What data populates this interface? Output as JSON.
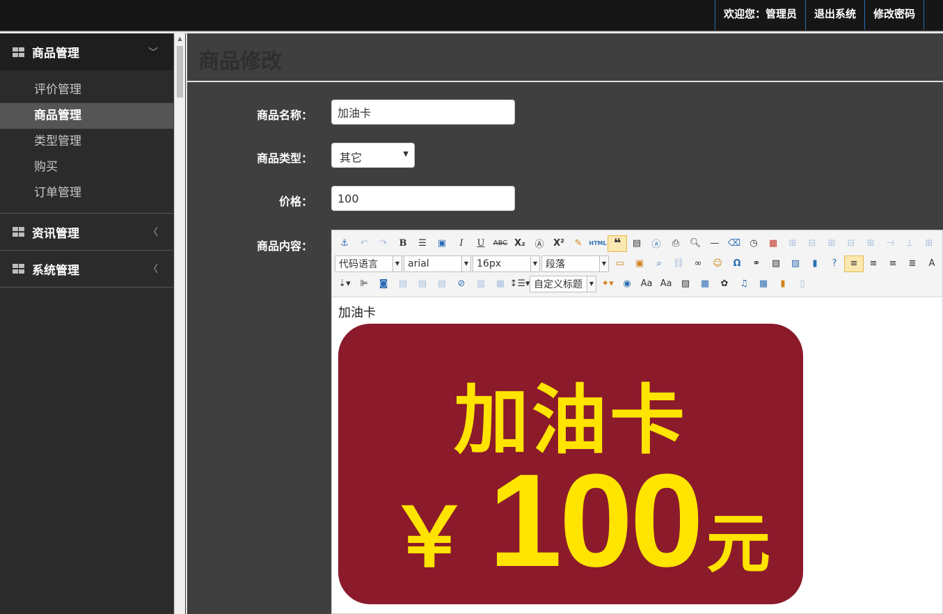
{
  "topbar": {
    "welcome": "欢迎您：管理员",
    "logout": "退出系统",
    "change_password": "修改密码"
  },
  "sidebar": {
    "groups": [
      {
        "label": "商品管理",
        "arrow": "﹀",
        "items": [
          "评价管理",
          "商品管理",
          "类型管理",
          "购买",
          "订单管理"
        ]
      },
      {
        "label": "资讯管理",
        "arrow": "〈"
      },
      {
        "label": "系统管理",
        "arrow": "〈"
      }
    ]
  },
  "page": {
    "title": "商品修改"
  },
  "form": {
    "name_label": "商品名称：",
    "name_value": "加油卡",
    "type_label": "商品类型：",
    "type_value": "其它",
    "price_label": "价格：",
    "price_value": "100",
    "content_label": "商品内容："
  },
  "editor": {
    "combo_code": "代码语言",
    "combo_font": "arial",
    "combo_size": "16px",
    "combo_para": "段落",
    "combo_title": "自定义标题",
    "content_text": "加油卡",
    "card_title": "加油卡",
    "card_yen": "￥",
    "card_amount": "100",
    "card_unit": "元"
  },
  "colors": {
    "card_bg": "#8b1a2b",
    "card_text": "#ffe400",
    "accent_border": "#2a6fb0"
  }
}
